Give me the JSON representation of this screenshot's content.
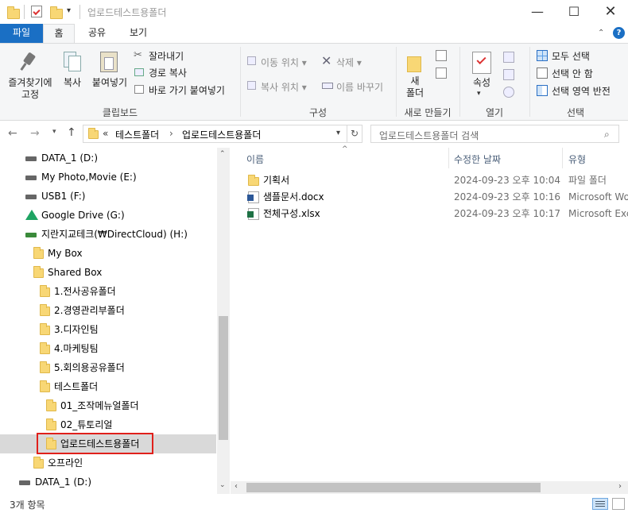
{
  "window": {
    "title": "업로드테스트용폴더"
  },
  "tabs": [
    {
      "label": "파일"
    },
    {
      "label": "홈"
    },
    {
      "label": "공유"
    },
    {
      "label": "보기"
    }
  ],
  "ribbon": {
    "clipboard": {
      "group_label": "클립보드",
      "pin_label": "즐겨찾기에\n고정",
      "copy_label": "복사",
      "paste_label": "붙여넣기",
      "cut_label": "잘라내기",
      "copy_path_label": "경로 복사",
      "paste_shortcut_label": "바로 가기 붙여넣기"
    },
    "organize": {
      "group_label": "구성",
      "move_to_label": "이동 위치",
      "copy_to_label": "복사 위치",
      "delete_label": "삭제",
      "rename_label": "이름 바꾸기"
    },
    "new": {
      "group_label": "새로 만들기",
      "new_folder_label": "새\n폴더"
    },
    "open": {
      "group_label": "열기",
      "properties_label": "속성"
    },
    "select": {
      "group_label": "선택",
      "select_all_label": "모두 선택",
      "select_none_label": "선택 안 함",
      "invert_label": "선택 영역 반전"
    }
  },
  "address": {
    "prefix": "«",
    "crumbs": [
      "테스트폴더",
      "업로드테스트용폴더"
    ],
    "separator": "›"
  },
  "search": {
    "placeholder": "업로드테스트용폴더 검색"
  },
  "nav": {
    "items": [
      {
        "label": "DATA_1 (D:)",
        "type": "drive"
      },
      {
        "label": "My Photo,Movie (E:)",
        "type": "drive"
      },
      {
        "label": "USB1 (F:)",
        "type": "drive"
      },
      {
        "label": "Google Drive (G:)",
        "type": "gdrive"
      },
      {
        "label": "지란지교테크(₩DirectCloud) (H:)",
        "type": "netdrive"
      },
      {
        "label": "My Box",
        "type": "folder"
      },
      {
        "label": "Shared Box",
        "type": "folder"
      },
      {
        "label": "1.전사공유폴더",
        "type": "folder"
      },
      {
        "label": "2.경영관리부폴더",
        "type": "folder"
      },
      {
        "label": "3.디자인팀",
        "type": "folder"
      },
      {
        "label": "4.마케팅팀",
        "type": "folder"
      },
      {
        "label": "5.회의용공유폴더",
        "type": "folder"
      },
      {
        "label": "테스트폴더",
        "type": "folder"
      },
      {
        "label": "01_조작메뉴얼폴더",
        "type": "folder"
      },
      {
        "label": "02_튜토리얼",
        "type": "folder"
      },
      {
        "label": "업로드테스트용폴더",
        "type": "folder",
        "selected": true
      },
      {
        "label": "오프라인",
        "type": "folder"
      },
      {
        "label": "DATA_1 (D:)",
        "type": "drive"
      }
    ]
  },
  "columns": {
    "name": "이름",
    "modified": "수정한 날짜",
    "type": "유형"
  },
  "files": [
    {
      "name": "기획서",
      "modified": "2024-09-23 오후 10:04",
      "type": "파일 폴더",
      "icon": "folder-icon"
    },
    {
      "name": "샘플문서.docx",
      "modified": "2024-09-23 오후 10:16",
      "type": "Microsoft Word",
      "icon": "word-icon"
    },
    {
      "name": "전체구성.xlsx",
      "modified": "2024-09-23 오후 10:17",
      "type": "Microsoft Excel",
      "icon": "excel-icon"
    }
  ],
  "status": {
    "count": "3개 항목"
  },
  "colors": {
    "accent": "#1a6fc4",
    "highlight_border": "#e0201b",
    "selected_bg": "#d9d9d9"
  }
}
